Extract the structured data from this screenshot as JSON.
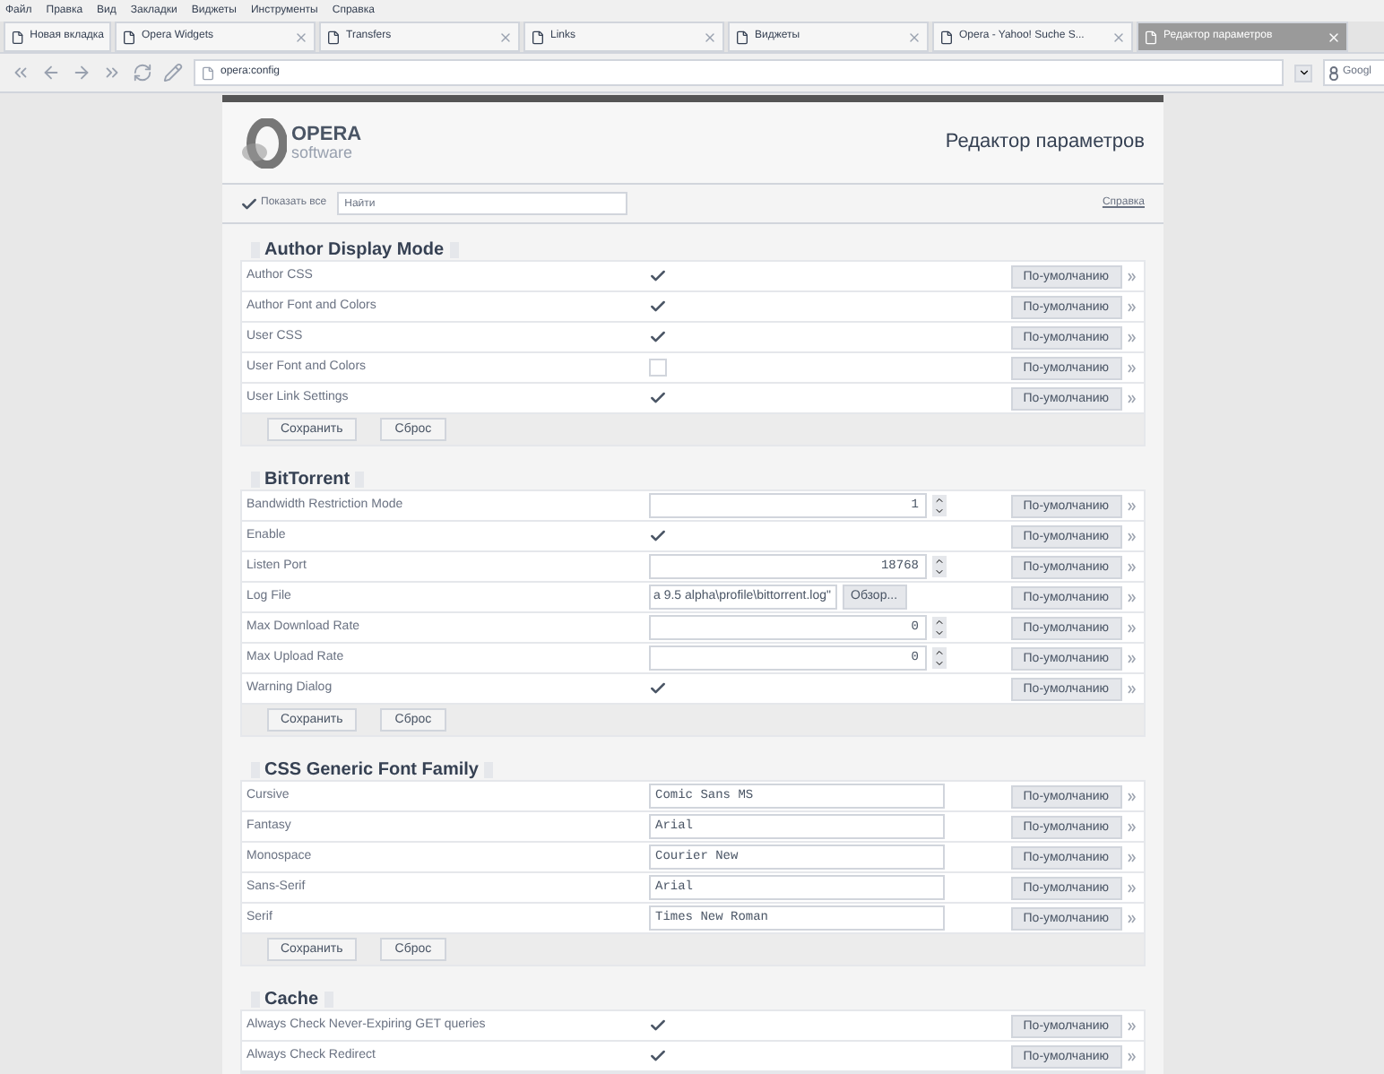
{
  "menu": [
    "Файл",
    "Правка",
    "Вид",
    "Закладки",
    "Виджеты",
    "Инструменты",
    "Справка"
  ],
  "tabs": [
    {
      "label": "Новая вкладка",
      "selected": false,
      "closable": false
    },
    {
      "label": "Opera Widgets",
      "selected": false,
      "closable": true
    },
    {
      "label": "Transfers",
      "selected": false,
      "closable": true
    },
    {
      "label": "Links",
      "selected": false,
      "closable": true
    },
    {
      "label": "Виджеты",
      "selected": false,
      "closable": true
    },
    {
      "label": "Opera - Yahoo! Suche S...",
      "selected": false,
      "closable": true
    },
    {
      "label": "Редактор параметров",
      "selected": true,
      "closable": true
    }
  ],
  "address": {
    "value": "opera:config"
  },
  "search": {
    "placeholder": "Googl"
  },
  "header": {
    "logo_word": "OPERA",
    "logo_sub": "software",
    "title": "Редактор параметров"
  },
  "toolbar": {
    "show_all": {
      "label": "Показать все",
      "checked": true
    },
    "find": {
      "placeholder": "Найти"
    },
    "help": "Справка"
  },
  "sections": [
    {
      "title": "Author Display Mode",
      "save": "Сохранить",
      "reset": "Сброс",
      "rows": [
        {
          "name": "Author CSS",
          "kind": "checkbox",
          "checked": true,
          "default": "По-умолчанию"
        },
        {
          "name": "Author Font and Colors",
          "kind": "checkbox",
          "checked": true,
          "default": "По-умолчанию"
        },
        {
          "name": "User CSS",
          "kind": "checkbox",
          "checked": true,
          "default": "По-умолчанию"
        },
        {
          "name": "User Font and Colors",
          "kind": "checkbox",
          "checked": false,
          "default": "По-умолчанию"
        },
        {
          "name": "User Link Settings",
          "kind": "checkbox",
          "checked": true,
          "default": "По-умолчанию"
        }
      ]
    },
    {
      "title": "BitTorrent",
      "save": "Сохранить",
      "reset": "Сброс",
      "rows": [
        {
          "name": "Bandwidth Restriction Mode",
          "kind": "number",
          "value": "1",
          "default": "По-умолчанию"
        },
        {
          "name": "Enable",
          "kind": "checkbox",
          "checked": true,
          "default": "По-умолчанию"
        },
        {
          "name": "Listen Port",
          "kind": "number",
          "value": "18768",
          "default": "По-умолчанию"
        },
        {
          "name": "Log File",
          "kind": "file",
          "value": "a 9.5 alpha\\profile\\bittorrent.log\"",
          "browse": "Обзор...",
          "default": "По-умолчанию"
        },
        {
          "name": "Max Download Rate",
          "kind": "number",
          "value": "0",
          "default": "По-умолчанию"
        },
        {
          "name": "Max Upload Rate",
          "kind": "number",
          "value": "0",
          "default": "По-умолчанию"
        },
        {
          "name": "Warning Dialog",
          "kind": "checkbox",
          "checked": true,
          "default": "По-умолчанию"
        }
      ]
    },
    {
      "title": "CSS Generic Font Family",
      "save": "Сохранить",
      "reset": "Сброс",
      "rows": [
        {
          "name": "Cursive",
          "kind": "text",
          "value": "Comic Sans MS",
          "default": "По-умолчанию"
        },
        {
          "name": "Fantasy",
          "kind": "text",
          "value": "Arial",
          "default": "По-умолчанию"
        },
        {
          "name": "Monospace",
          "kind": "text",
          "value": "Courier New",
          "default": "По-умолчанию"
        },
        {
          "name": "Sans-Serif",
          "kind": "text",
          "value": "Arial",
          "default": "По-умолчанию"
        },
        {
          "name": "Serif",
          "kind": "text",
          "value": "Times New Roman",
          "default": "По-умолчанию"
        }
      ]
    },
    {
      "title": "Cache",
      "rows": [
        {
          "name": "Always Check Never-Expiring GET queries",
          "kind": "checkbox",
          "checked": true,
          "default": "По-умолчанию"
        },
        {
          "name": "Always Check Redirect",
          "kind": "checkbox",
          "checked": true,
          "default": "По-умолчанию"
        }
      ]
    }
  ]
}
